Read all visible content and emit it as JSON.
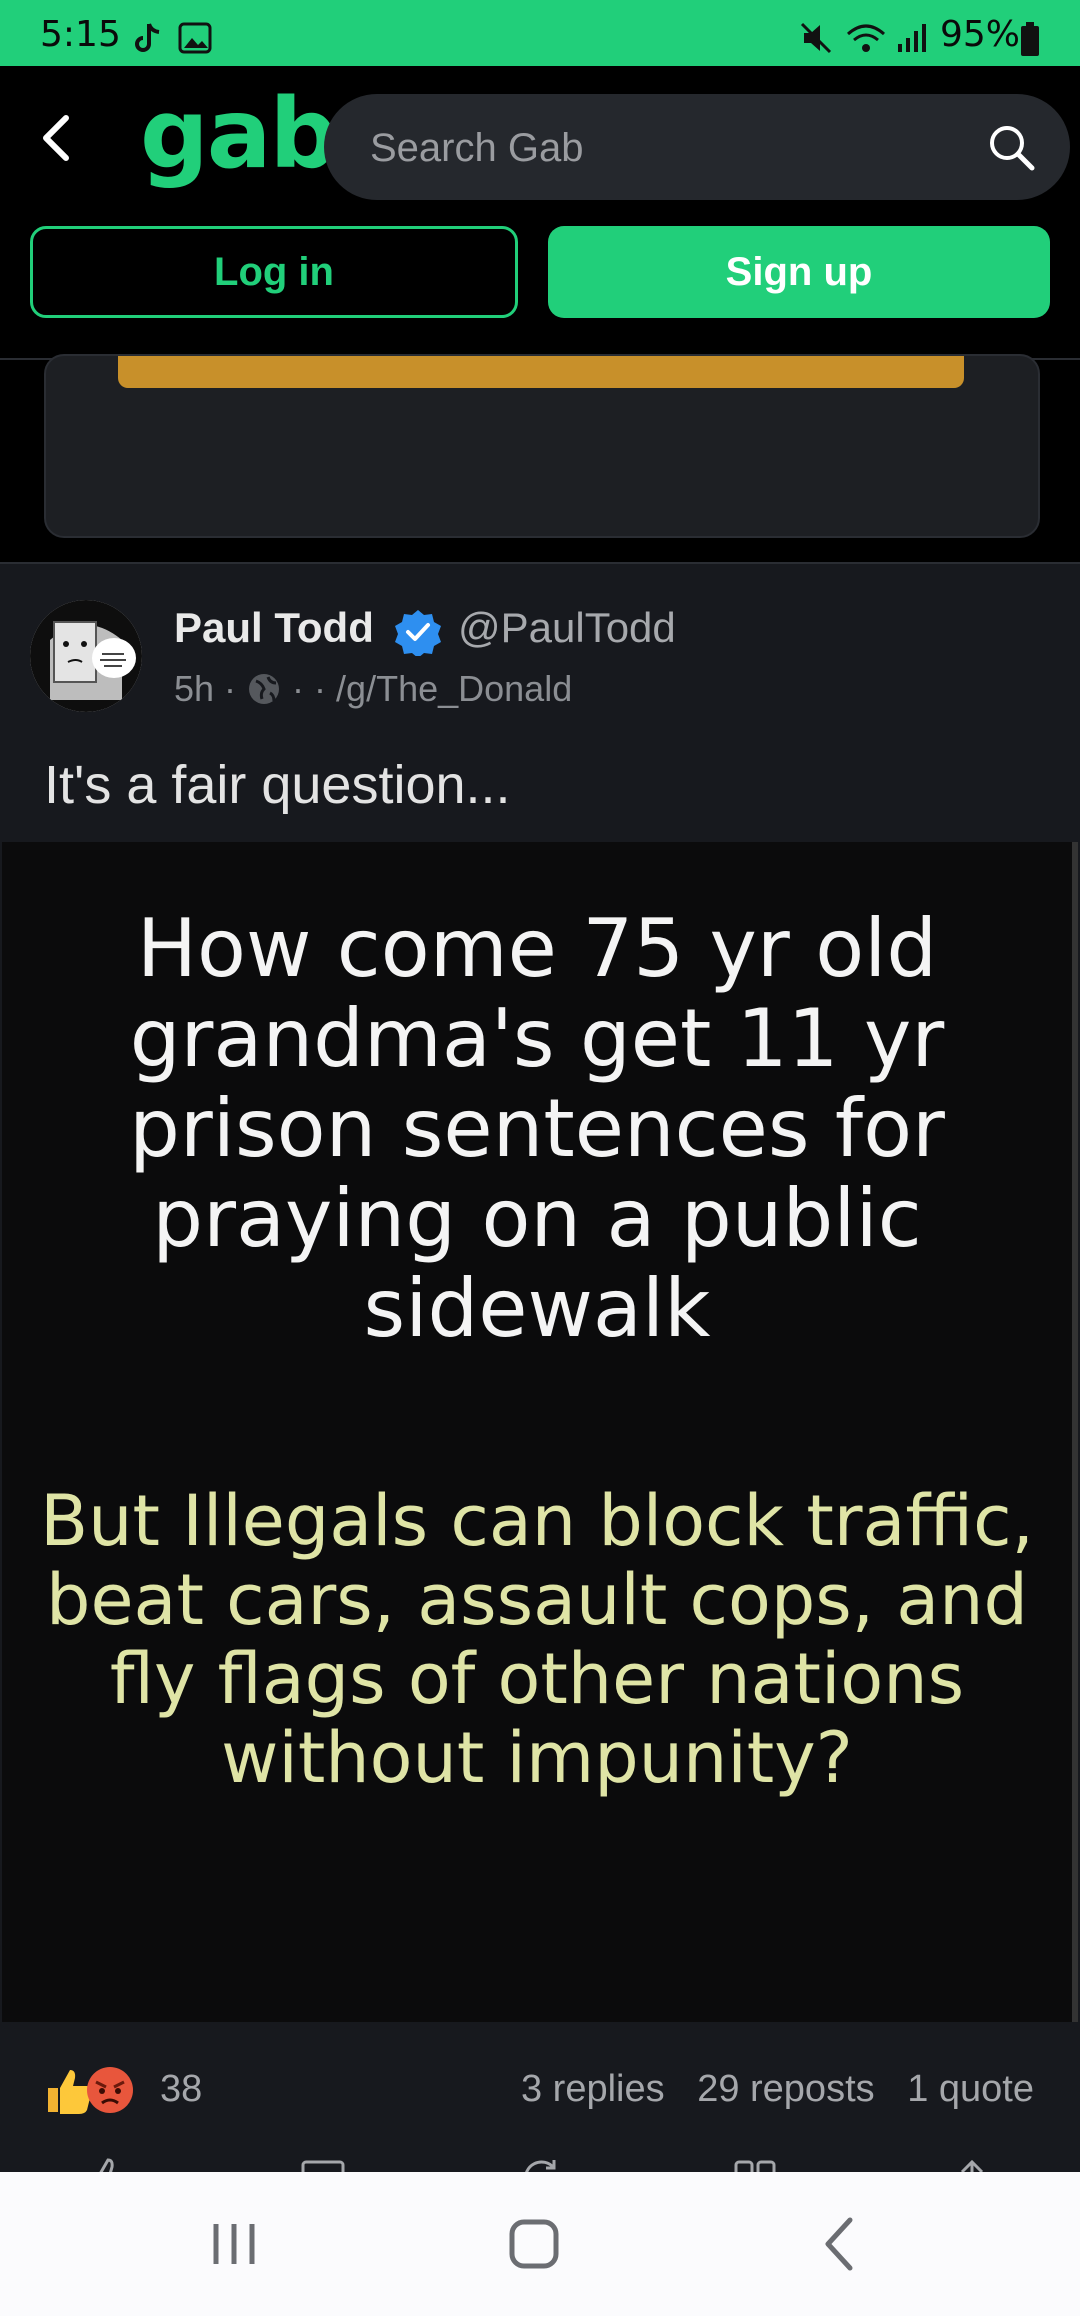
{
  "status_bar": {
    "time": "5:15",
    "battery": "95%",
    "icons": [
      "tiktok-icon",
      "gallery-icon",
      "mute-icon",
      "wifi-icon",
      "signal-icon",
      "battery-icon"
    ]
  },
  "header": {
    "logo": "gab",
    "search_placeholder": "Search Gab",
    "login_label": "Log in",
    "signup_label": "Sign up"
  },
  "post": {
    "author_name": "Paul Todd",
    "handle": "@PaulTodd",
    "time_ago": "5h",
    "group": "/g/The_Donald",
    "text": "It's a fair question...",
    "image_text_white": "How come 75 yr old grandma's get 11 yr prison sentences for praying on a public sidewalk",
    "image_text_yellow": "But Illegals can block traffic, beat cars, assault cops, and fly flags of other nations without impunity?",
    "reaction_count": "38",
    "replies": "3 replies",
    "reposts": "29 reposts",
    "quotes": "1 quote"
  },
  "colors": {
    "brand": "#21cf7a",
    "background": "#17191e",
    "gold_bar": "#c8902a"
  }
}
